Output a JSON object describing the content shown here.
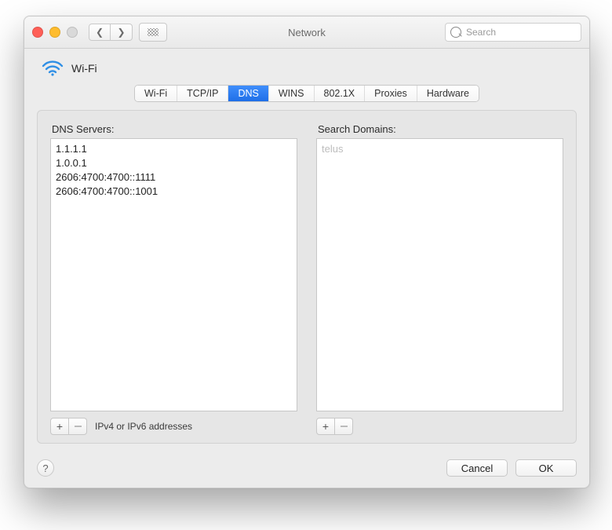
{
  "window": {
    "title": "Network"
  },
  "search": {
    "placeholder": "Search"
  },
  "header": {
    "interface": "Wi-Fi"
  },
  "tabs": {
    "wifi": "Wi-Fi",
    "tcpip": "TCP/IP",
    "dns": "DNS",
    "wins": "WINS",
    "dot1x": "802.1X",
    "proxies": "Proxies",
    "hardware": "Hardware",
    "active": "dns"
  },
  "dns": {
    "servers_label": "DNS Servers:",
    "servers": [
      "1.1.1.1",
      "1.0.0.1",
      "2606:4700:4700::1111",
      "2606:4700:4700::1001"
    ],
    "hint": "IPv4 or IPv6 addresses",
    "domains_label": "Search Domains:",
    "domains_placeholder": "telus"
  },
  "buttons": {
    "add": "+",
    "cancel": "Cancel",
    "ok": "OK",
    "help": "?"
  }
}
